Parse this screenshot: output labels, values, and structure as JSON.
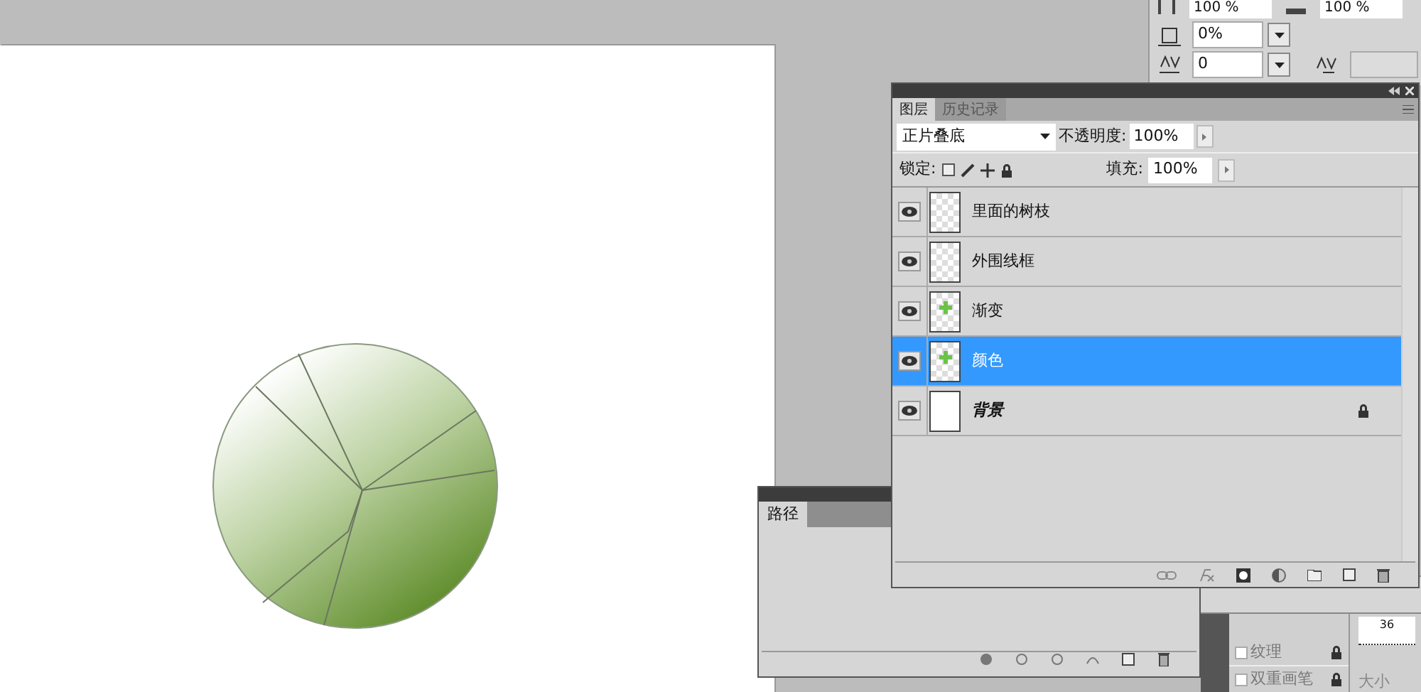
{
  "character_panel": {
    "top_fields": [
      "100 %",
      "100 %"
    ],
    "tsume": "0%",
    "tracking": "0"
  },
  "layers_panel": {
    "tabs": [
      {
        "label": "图层",
        "selected": true
      },
      {
        "label": "历史记录",
        "selected": false
      }
    ],
    "blend_mode": "正片叠底",
    "opacity_label": "不透明度:",
    "opacity": "100%",
    "lock_label": "锁定:",
    "fill_label": "填充:",
    "fill": "100%",
    "layers": [
      {
        "name": "里面的树枝",
        "kind": "layer",
        "visible": true,
        "selected": false,
        "locked": false
      },
      {
        "name": "外围线框",
        "kind": "layer",
        "visible": true,
        "selected": false,
        "locked": false
      },
      {
        "name": "渐变",
        "kind": "mark",
        "visible": true,
        "selected": false,
        "locked": false
      },
      {
        "name": "颜色",
        "kind": "mark",
        "visible": true,
        "selected": true,
        "locked": false
      },
      {
        "name": "背景",
        "kind": "background",
        "visible": true,
        "selected": false,
        "locked": true
      }
    ]
  },
  "paths_panel": {
    "tabs": [
      {
        "label": "路径",
        "selected": true
      }
    ]
  },
  "brush_panel": {
    "options": [
      {
        "label": "纹理",
        "checked": false
      },
      {
        "label": "双重画笔",
        "checked": false
      }
    ],
    "preview": "36",
    "size_label": "大小"
  }
}
